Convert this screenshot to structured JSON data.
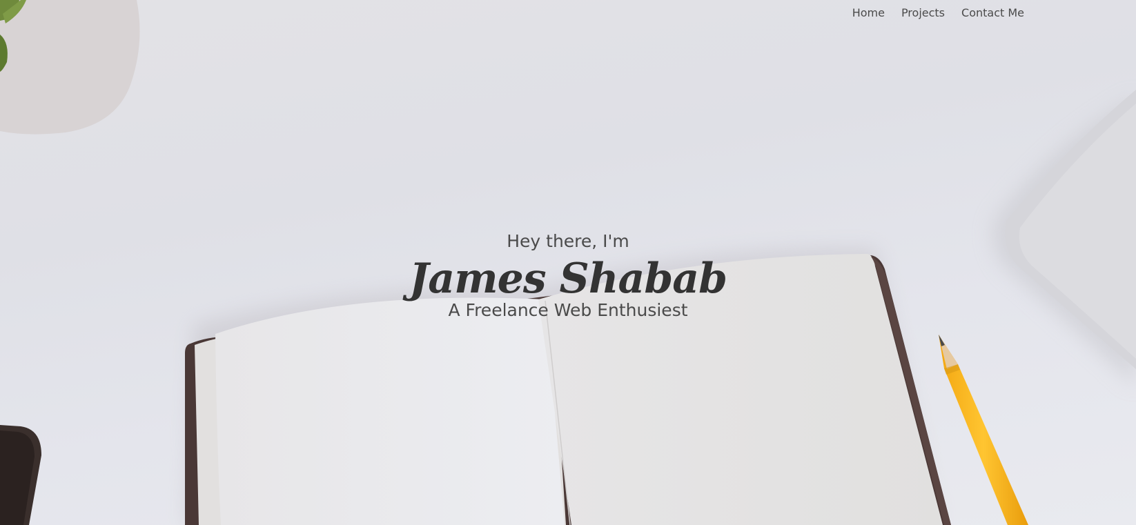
{
  "nav": {
    "items": [
      {
        "label": "Home"
      },
      {
        "label": "Projects"
      },
      {
        "label": "Contact Me"
      }
    ]
  },
  "hero": {
    "greeting": "Hey there, I'm",
    "name": "James Shabab",
    "tagline": "A Freelance Web Enthusiest"
  },
  "colors": {
    "background": "#e2e3e9",
    "text": "#333333",
    "nav_text": "#4a4a4a",
    "pencil": "#f7b21a"
  },
  "icons": [
    "plant-decor",
    "notebook-decor",
    "pencil-decor",
    "laptop-decor",
    "phone-decor"
  ]
}
